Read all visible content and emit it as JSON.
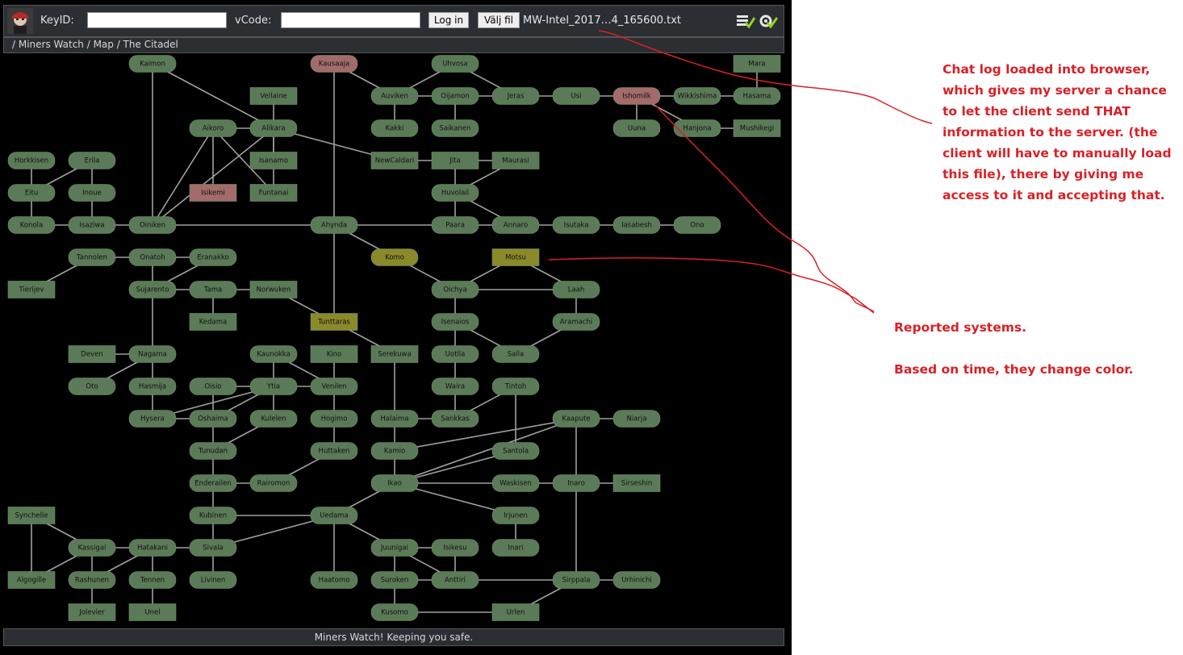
{
  "toolbar": {
    "keyid_label": "KeyID:",
    "keyid_value": "",
    "vcode_label": "vCode:",
    "vcode_value": "",
    "login_button": "Log in",
    "choose_file_button": "Välj fil",
    "filename": "MW-Intel_2017…4_165600.txt",
    "icons": [
      "checklist-icon",
      "settings-check-icon"
    ]
  },
  "breadcrumb": "/ Miners Watch / Map / The Citadel",
  "footer": "Miners Watch! Keeping you safe.",
  "annotations": {
    "note1": "Chat log loaded into browser, which gives my server a chance to let the client send THAT information to the server. (the client will have to manually load this file), there by giving me access to it and accepting that.",
    "note2_line1": "Reported systems.",
    "note2_line2": "Based on time, they change color."
  },
  "colors": {
    "normal": "#5b7a57",
    "hostile": "#a36b6a",
    "reported": "#8a8a2a",
    "edge": "#a0a0a0",
    "annotation": "#d92026"
  },
  "map": {
    "systems": [
      {
        "name": "Kaimon",
        "shape": "pill",
        "status": "normal"
      },
      {
        "name": "Kausaaja",
        "shape": "pill",
        "status": "hostile"
      },
      {
        "name": "Uhvosa",
        "shape": "pill",
        "status": "normal"
      },
      {
        "name": "Mara",
        "shape": "rect",
        "status": "normal"
      },
      {
        "name": "Vellaine",
        "shape": "rect",
        "status": "normal"
      },
      {
        "name": "Auviken",
        "shape": "pill",
        "status": "normal"
      },
      {
        "name": "Oijamon",
        "shape": "pill",
        "status": "normal"
      },
      {
        "name": "Jeras",
        "shape": "pill",
        "status": "normal"
      },
      {
        "name": "Usi",
        "shape": "pill",
        "status": "normal"
      },
      {
        "name": "Ishomilk",
        "shape": "pill",
        "status": "hostile"
      },
      {
        "name": "Wikkishima",
        "shape": "pill",
        "status": "normal"
      },
      {
        "name": "Hasama",
        "shape": "pill",
        "status": "normal"
      },
      {
        "name": "Aikoro",
        "shape": "pill",
        "status": "normal"
      },
      {
        "name": "Alikara",
        "shape": "pill",
        "status": "normal"
      },
      {
        "name": "Kakki",
        "shape": "pill",
        "status": "normal"
      },
      {
        "name": "Saikanen",
        "shape": "pill",
        "status": "normal"
      },
      {
        "name": "Uuna",
        "shape": "pill",
        "status": "normal"
      },
      {
        "name": "Hanjona",
        "shape": "pill",
        "status": "normal"
      },
      {
        "name": "Mushikegi",
        "shape": "rect",
        "status": "normal"
      },
      {
        "name": "Horkkisen",
        "shape": "pill",
        "status": "normal"
      },
      {
        "name": "Erila",
        "shape": "pill",
        "status": "normal"
      },
      {
        "name": "Isanamo",
        "shape": "rect",
        "status": "normal"
      },
      {
        "name": "NewCaldari",
        "shape": "rect",
        "status": "normal"
      },
      {
        "name": "Jita",
        "shape": "rect",
        "status": "normal"
      },
      {
        "name": "Maurasi",
        "shape": "rect",
        "status": "normal"
      },
      {
        "name": "Eitu",
        "shape": "pill",
        "status": "normal"
      },
      {
        "name": "Inoue",
        "shape": "pill",
        "status": "normal"
      },
      {
        "name": "Isikemi",
        "shape": "rect",
        "status": "hostile"
      },
      {
        "name": "Funtanai",
        "shape": "rect",
        "status": "normal"
      },
      {
        "name": "Huvolail",
        "shape": "pill",
        "status": "normal"
      },
      {
        "name": "Konola",
        "shape": "pill",
        "status": "normal"
      },
      {
        "name": "Isaziwa",
        "shape": "pill",
        "status": "normal"
      },
      {
        "name": "Oiniken",
        "shape": "pill",
        "status": "normal"
      },
      {
        "name": "Ahynda",
        "shape": "pill",
        "status": "normal"
      },
      {
        "name": "Paara",
        "shape": "pill",
        "status": "normal"
      },
      {
        "name": "Annaro",
        "shape": "pill",
        "status": "normal"
      },
      {
        "name": "Isutaka",
        "shape": "pill",
        "status": "normal"
      },
      {
        "name": "Iasabesh",
        "shape": "pill",
        "status": "normal"
      },
      {
        "name": "Ono",
        "shape": "pill",
        "status": "normal"
      },
      {
        "name": "Tannolen",
        "shape": "pill",
        "status": "normal"
      },
      {
        "name": "Onatoh",
        "shape": "pill",
        "status": "normal"
      },
      {
        "name": "Eranakko",
        "shape": "pill",
        "status": "normal"
      },
      {
        "name": "Komo",
        "shape": "pill",
        "status": "reported"
      },
      {
        "name": "Motsu",
        "shape": "rect",
        "status": "reported"
      },
      {
        "name": "Tierijev",
        "shape": "rect",
        "status": "normal"
      },
      {
        "name": "Sujarento",
        "shape": "pill",
        "status": "normal"
      },
      {
        "name": "Tama",
        "shape": "pill",
        "status": "normal"
      },
      {
        "name": "Norwuken",
        "shape": "rect",
        "status": "normal"
      },
      {
        "name": "Oichya",
        "shape": "pill",
        "status": "normal"
      },
      {
        "name": "Laah",
        "shape": "pill",
        "status": "normal"
      },
      {
        "name": "Kedama",
        "shape": "rect",
        "status": "normal"
      },
      {
        "name": "Tunttaras",
        "shape": "rect",
        "status": "reported"
      },
      {
        "name": "Isenaios",
        "shape": "pill",
        "status": "normal"
      },
      {
        "name": "Aramachi",
        "shape": "pill",
        "status": "normal"
      },
      {
        "name": "Deven",
        "shape": "rect",
        "status": "normal"
      },
      {
        "name": "Nagama",
        "shape": "pill",
        "status": "normal"
      },
      {
        "name": "Kaunokka",
        "shape": "pill",
        "status": "normal"
      },
      {
        "name": "Kino",
        "shape": "rect",
        "status": "normal"
      },
      {
        "name": "Serekuwa",
        "shape": "rect",
        "status": "normal"
      },
      {
        "name": "Uotila",
        "shape": "pill",
        "status": "normal"
      },
      {
        "name": "Saila",
        "shape": "pill",
        "status": "normal"
      },
      {
        "name": "Oto",
        "shape": "pill",
        "status": "normal"
      },
      {
        "name": "Hasmija",
        "shape": "pill",
        "status": "normal"
      },
      {
        "name": "Oisio",
        "shape": "pill",
        "status": "normal"
      },
      {
        "name": "Ytia",
        "shape": "pill",
        "status": "normal"
      },
      {
        "name": "Venilen",
        "shape": "pill",
        "status": "normal"
      },
      {
        "name": "Waira",
        "shape": "pill",
        "status": "normal"
      },
      {
        "name": "Tintoh",
        "shape": "pill",
        "status": "normal"
      },
      {
        "name": "Hysera",
        "shape": "pill",
        "status": "normal"
      },
      {
        "name": "Oshaima",
        "shape": "pill",
        "status": "normal"
      },
      {
        "name": "Kulelen",
        "shape": "pill",
        "status": "normal"
      },
      {
        "name": "Hogimo",
        "shape": "pill",
        "status": "normal"
      },
      {
        "name": "Halaima",
        "shape": "pill",
        "status": "normal"
      },
      {
        "name": "Sankkas",
        "shape": "pill",
        "status": "normal"
      },
      {
        "name": "Kaapute",
        "shape": "pill",
        "status": "normal"
      },
      {
        "name": "Niarja",
        "shape": "pill",
        "status": "normal"
      },
      {
        "name": "Tunudan",
        "shape": "pill",
        "status": "normal"
      },
      {
        "name": "Huttaken",
        "shape": "pill",
        "status": "normal"
      },
      {
        "name": "Kamio",
        "shape": "pill",
        "status": "normal"
      },
      {
        "name": "Santola",
        "shape": "pill",
        "status": "normal"
      },
      {
        "name": "Enderailen",
        "shape": "pill",
        "status": "normal"
      },
      {
        "name": "Rairomon",
        "shape": "pill",
        "status": "normal"
      },
      {
        "name": "Ikao",
        "shape": "pill",
        "status": "normal"
      },
      {
        "name": "Waskisen",
        "shape": "pill",
        "status": "normal"
      },
      {
        "name": "Inaro",
        "shape": "pill",
        "status": "normal"
      },
      {
        "name": "Sirseshin",
        "shape": "rect",
        "status": "normal"
      },
      {
        "name": "Synchelle",
        "shape": "rect",
        "status": "normal"
      },
      {
        "name": "Kubinen",
        "shape": "pill",
        "status": "normal"
      },
      {
        "name": "Uedama",
        "shape": "pill",
        "status": "normal"
      },
      {
        "name": "Irjunen",
        "shape": "pill",
        "status": "normal"
      },
      {
        "name": "Kassigai",
        "shape": "pill",
        "status": "normal"
      },
      {
        "name": "Hatakani",
        "shape": "pill",
        "status": "normal"
      },
      {
        "name": "Sivala",
        "shape": "pill",
        "status": "normal"
      },
      {
        "name": "Juunigai",
        "shape": "pill",
        "status": "normal"
      },
      {
        "name": "Isikesu",
        "shape": "pill",
        "status": "normal"
      },
      {
        "name": "Inari",
        "shape": "pill",
        "status": "normal"
      },
      {
        "name": "Algogille",
        "shape": "rect",
        "status": "normal"
      },
      {
        "name": "Rashunen",
        "shape": "pill",
        "status": "normal"
      },
      {
        "name": "Tennen",
        "shape": "pill",
        "status": "normal"
      },
      {
        "name": "Livinen",
        "shape": "pill",
        "status": "normal"
      },
      {
        "name": "Haatomo",
        "shape": "pill",
        "status": "normal"
      },
      {
        "name": "Suroken",
        "shape": "pill",
        "status": "normal"
      },
      {
        "name": "Anttiri",
        "shape": "pill",
        "status": "normal"
      },
      {
        "name": "Sirppala",
        "shape": "pill",
        "status": "normal"
      },
      {
        "name": "Urhinichi",
        "shape": "pill",
        "status": "normal"
      },
      {
        "name": "Jolevier",
        "shape": "rect",
        "status": "normal"
      },
      {
        "name": "Unel",
        "shape": "rect",
        "status": "normal"
      },
      {
        "name": "Kusomo",
        "shape": "pill",
        "status": "normal"
      },
      {
        "name": "Urlen",
        "shape": "rect",
        "status": "normal"
      }
    ],
    "connections": [
      [
        "Kaimon",
        "Oiniken"
      ],
      [
        "Kaimon",
        "Alikara"
      ],
      [
        "Kausaaja",
        "Ahynda"
      ],
      [
        "Kausaaja",
        "Auviken"
      ],
      [
        "Uhvosa",
        "Auviken"
      ],
      [
        "Uhvosa",
        "Jeras"
      ],
      [
        "Auviken",
        "Oijamon"
      ],
      [
        "Oijamon",
        "Jeras"
      ],
      [
        "Auviken",
        "Kakki"
      ],
      [
        "Oijamon",
        "Saikanen"
      ],
      [
        "Jeras",
        "Usi"
      ],
      [
        "Usi",
        "Ishomilk"
      ],
      [
        "Ishomilk",
        "Wikkishima"
      ],
      [
        "Wikkishima",
        "Hasama"
      ],
      [
        "Mara",
        "Hasama"
      ],
      [
        "Ishomilk",
        "Uuna"
      ],
      [
        "Ishomilk",
        "Hanjona"
      ],
      [
        "Hanjona",
        "Mushikegi"
      ],
      [
        "Vellaine",
        "Alikara"
      ],
      [
        "Aikoro",
        "Alikara"
      ],
      [
        "Alikara",
        "Isanamo"
      ],
      [
        "Alikara",
        "NewCaldari"
      ],
      [
        "Aikoro",
        "Isikemi"
      ],
      [
        "Aikoro",
        "Funtanai"
      ],
      [
        "Aikoro",
        "Oiniken"
      ],
      [
        "Alikara",
        "Funtanai"
      ],
      [
        "Alikara",
        "Oiniken"
      ],
      [
        "NewCaldari",
        "Jita"
      ],
      [
        "Jita",
        "Maurasi"
      ],
      [
        "Jita",
        "Huvolail"
      ],
      [
        "Huvolail",
        "Maurasi"
      ],
      [
        "Huvolail",
        "Paara"
      ],
      [
        "Huvolail",
        "Annaro"
      ],
      [
        "Horkkisen",
        "Eitu"
      ],
      [
        "Erila",
        "Eitu"
      ],
      [
        "Erila",
        "Inoue"
      ],
      [
        "Eitu",
        "Konola"
      ],
      [
        "Inoue",
        "Isaziwa"
      ],
      [
        "Konola",
        "Isaziwa"
      ],
      [
        "Isaziwa",
        "Oiniken"
      ],
      [
        "Oiniken",
        "Ahynda"
      ],
      [
        "Ahynda",
        "Paara"
      ],
      [
        "Paara",
        "Annaro"
      ],
      [
        "Annaro",
        "Isutaka"
      ],
      [
        "Isutaka",
        "Iasabesh"
      ],
      [
        "Iasabesh",
        "Ono"
      ],
      [
        "Ahynda",
        "Komo"
      ],
      [
        "Ahynda",
        "Tunttaras"
      ],
      [
        "Tannolen",
        "Onatoh"
      ],
      [
        "Tannolen",
        "Tierijev"
      ],
      [
        "Onatoh",
        "Eranakko"
      ],
      [
        "Onatoh",
        "Sujarento"
      ],
      [
        "Eranakko",
        "Sujarento"
      ],
      [
        "Sujarento",
        "Tama"
      ],
      [
        "Tama",
        "Norwuken"
      ],
      [
        "Tama",
        "Kedama"
      ],
      [
        "Norwuken",
        "Tunttaras"
      ],
      [
        "Sujarento",
        "Nagama"
      ],
      [
        "Komo",
        "Oichya"
      ],
      [
        "Motsu",
        "Oichya"
      ],
      [
        "Motsu",
        "Laah"
      ],
      [
        "Oichya",
        "Laah"
      ],
      [
        "Oichya",
        "Isenaios"
      ],
      [
        "Laah",
        "Aramachi"
      ],
      [
        "Aramachi",
        "Saila"
      ],
      [
        "Isenaios",
        "Uotila"
      ],
      [
        "Isenaios",
        "Saila"
      ],
      [
        "Tunttaras",
        "Serekuwa"
      ],
      [
        "Deven",
        "Nagama"
      ],
      [
        "Nagama",
        "Oto"
      ],
      [
        "Nagama",
        "Hasmija"
      ],
      [
        "Kaunokka",
        "Ytia"
      ],
      [
        "Kaunokka",
        "Venilen"
      ],
      [
        "Kino",
        "Venilen"
      ],
      [
        "Serekuwa",
        "Halaima"
      ],
      [
        "Uotila",
        "Waira"
      ],
      [
        "Oisio",
        "Ytia"
      ],
      [
        "Oisio",
        "Oshaima"
      ],
      [
        "Hasmija",
        "Hysera"
      ],
      [
        "Ytia",
        "Oshaima"
      ],
      [
        "Ytia",
        "Kulelen"
      ],
      [
        "Ytia",
        "Hysera"
      ],
      [
        "Ytia",
        "Venilen"
      ],
      [
        "Venilen",
        "Hogimo"
      ],
      [
        "Waira",
        "Sankkas"
      ],
      [
        "Tintoh",
        "Sankkas"
      ],
      [
        "Tintoh",
        "Santola"
      ],
      [
        "Halaima",
        "Sankkas"
      ],
      [
        "Halaima",
        "Kamio"
      ],
      [
        "Hysera",
        "Oshaima"
      ],
      [
        "Kaapute",
        "Niarja"
      ],
      [
        "Kaapute",
        "Kamio"
      ],
      [
        "Kaapute",
        "Ikao"
      ],
      [
        "Kaapute",
        "Inaro"
      ],
      [
        "Oshaima",
        "Tunudan"
      ],
      [
        "Kulelen",
        "Tunudan"
      ],
      [
        "Hogimo",
        "Huttaken"
      ],
      [
        "Huttaken",
        "Rairomon"
      ],
      [
        "Kamio",
        "Ikao"
      ],
      [
        "Santola",
        "Ikao"
      ],
      [
        "Tunudan",
        "Enderailen"
      ],
      [
        "Enderailen",
        "Rairomon"
      ],
      [
        "Enderailen",
        "Kubinen"
      ],
      [
        "Ikao",
        "Waskisen"
      ],
      [
        "Ikao",
        "Irjunen"
      ],
      [
        "Ikao",
        "Uedama"
      ],
      [
        "Waskisen",
        "Inaro"
      ],
      [
        "Inaro",
        "Sirseshin"
      ],
      [
        "Inaro",
        "Sirppala"
      ],
      [
        "Synchelle",
        "Kassigai"
      ],
      [
        "Synchelle",
        "Algogille"
      ],
      [
        "Kubinen",
        "Uedama"
      ],
      [
        "Kubinen",
        "Sivala"
      ],
      [
        "Uedama",
        "Sivala"
      ],
      [
        "Uedama",
        "Juunigai"
      ],
      [
        "Uedama",
        "Haatomo"
      ],
      [
        "Irjunen",
        "Inari"
      ],
      [
        "Kassigai",
        "Hatakani"
      ],
      [
        "Kassigai",
        "Algogille"
      ],
      [
        "Kassigai",
        "Rashunen"
      ],
      [
        "Hatakani",
        "Sivala"
      ],
      [
        "Hatakani",
        "Rashunen"
      ],
      [
        "Hatakani",
        "Tennen"
      ],
      [
        "Sivala",
        "Livinen"
      ],
      [
        "Juunigai",
        "Isikesu"
      ],
      [
        "Juunigai",
        "Suroken"
      ],
      [
        "Juunigai",
        "Anttiri"
      ],
      [
        "Isikesu",
        "Anttiri"
      ],
      [
        "Suroken",
        "Anttiri"
      ],
      [
        "Anttiri",
        "Sirppala"
      ],
      [
        "Sirppala",
        "Urhinichi"
      ],
      [
        "Sirppala",
        "Urlen"
      ],
      [
        "Rashunen",
        "Jolevier"
      ],
      [
        "Tennen",
        "Unel"
      ],
      [
        "Suroken",
        "Kusomo"
      ],
      [
        "Kusomo",
        "Urlen"
      ]
    ]
  }
}
